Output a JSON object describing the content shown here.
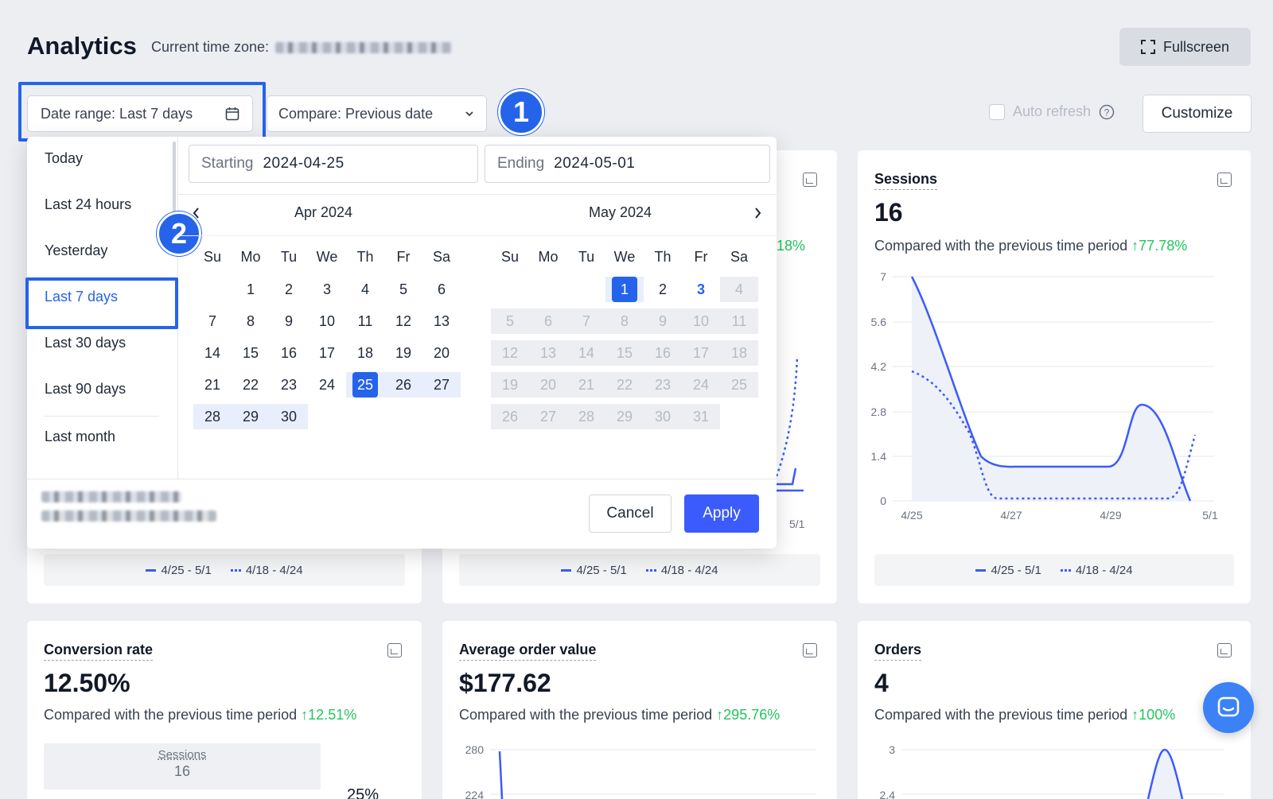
{
  "header": {
    "title": "Analytics",
    "timezone_label": "Current time zone:",
    "fullscreen_label": "Fullscreen"
  },
  "toolbar": {
    "date_range_label": "Date range: Last 7 days",
    "compare_label": "Compare: Previous date",
    "auto_refresh_label": "Auto refresh",
    "customize_label": "Customize"
  },
  "annotations": {
    "step1": "1",
    "step2": "2"
  },
  "date_picker": {
    "presets": [
      "Today",
      "Last 24 hours",
      "Yesterday",
      "Last 7 days",
      "Last 30 days",
      "Last 90 days",
      "Last month"
    ],
    "selected_preset": "Last 7 days",
    "starting_label": "Starting",
    "starting_value": "2024-04-25",
    "ending_label": "Ending",
    "ending_value": "2024-05-01",
    "left_month": "Apr  2024",
    "right_month": "May  2024",
    "weekdays": [
      "Su",
      "Mo",
      "Tu",
      "We",
      "Th",
      "Fr",
      "Sa"
    ],
    "cancel_label": "Cancel",
    "apply_label": "Apply"
  },
  "cards": {
    "sessions": {
      "title": "Sessions",
      "value": "16",
      "compare_text": "Compared with the previous time period",
      "change": "77.78%",
      "y_ticks": [
        "7",
        "5.6",
        "4.2",
        "2.8",
        "1.4",
        "0"
      ],
      "x_ticks": [
        "4/25",
        "4/27",
        "4/29",
        "5/1"
      ],
      "legend_current": "4/25 - 5/1",
      "legend_previous": "4/18 - 4/24"
    },
    "hidden1": {
      "legend_current": "4/25 - 5/1",
      "legend_previous": "4/18 - 4/24"
    },
    "hidden2": {
      "legend_current": "4/25 - 5/1",
      "legend_previous": "4/18 - 4/24",
      "change_fragment": "18%",
      "x_tick": "5/1"
    },
    "conversion": {
      "title": "Conversion rate",
      "value": "12.50%",
      "compare_text": "Compared with the previous time period",
      "change": "12.51%",
      "funnel_label": "Sessions",
      "funnel_value": "16",
      "funnel_pct": "25%"
    },
    "aov": {
      "title": "Average order value",
      "value": "$177.62",
      "compare_text": "Compared with the previous time period",
      "change": "295.76%",
      "y_ticks": [
        "280",
        "224"
      ]
    },
    "orders": {
      "title": "Orders",
      "value": "4",
      "compare_text": "Compared with the previous time period",
      "change": "100%",
      "y_ticks": [
        "3",
        "2.4"
      ]
    }
  },
  "colors": {
    "accent": "#2563eb",
    "positive": "#22c55e",
    "line": "#3b5bfd"
  }
}
